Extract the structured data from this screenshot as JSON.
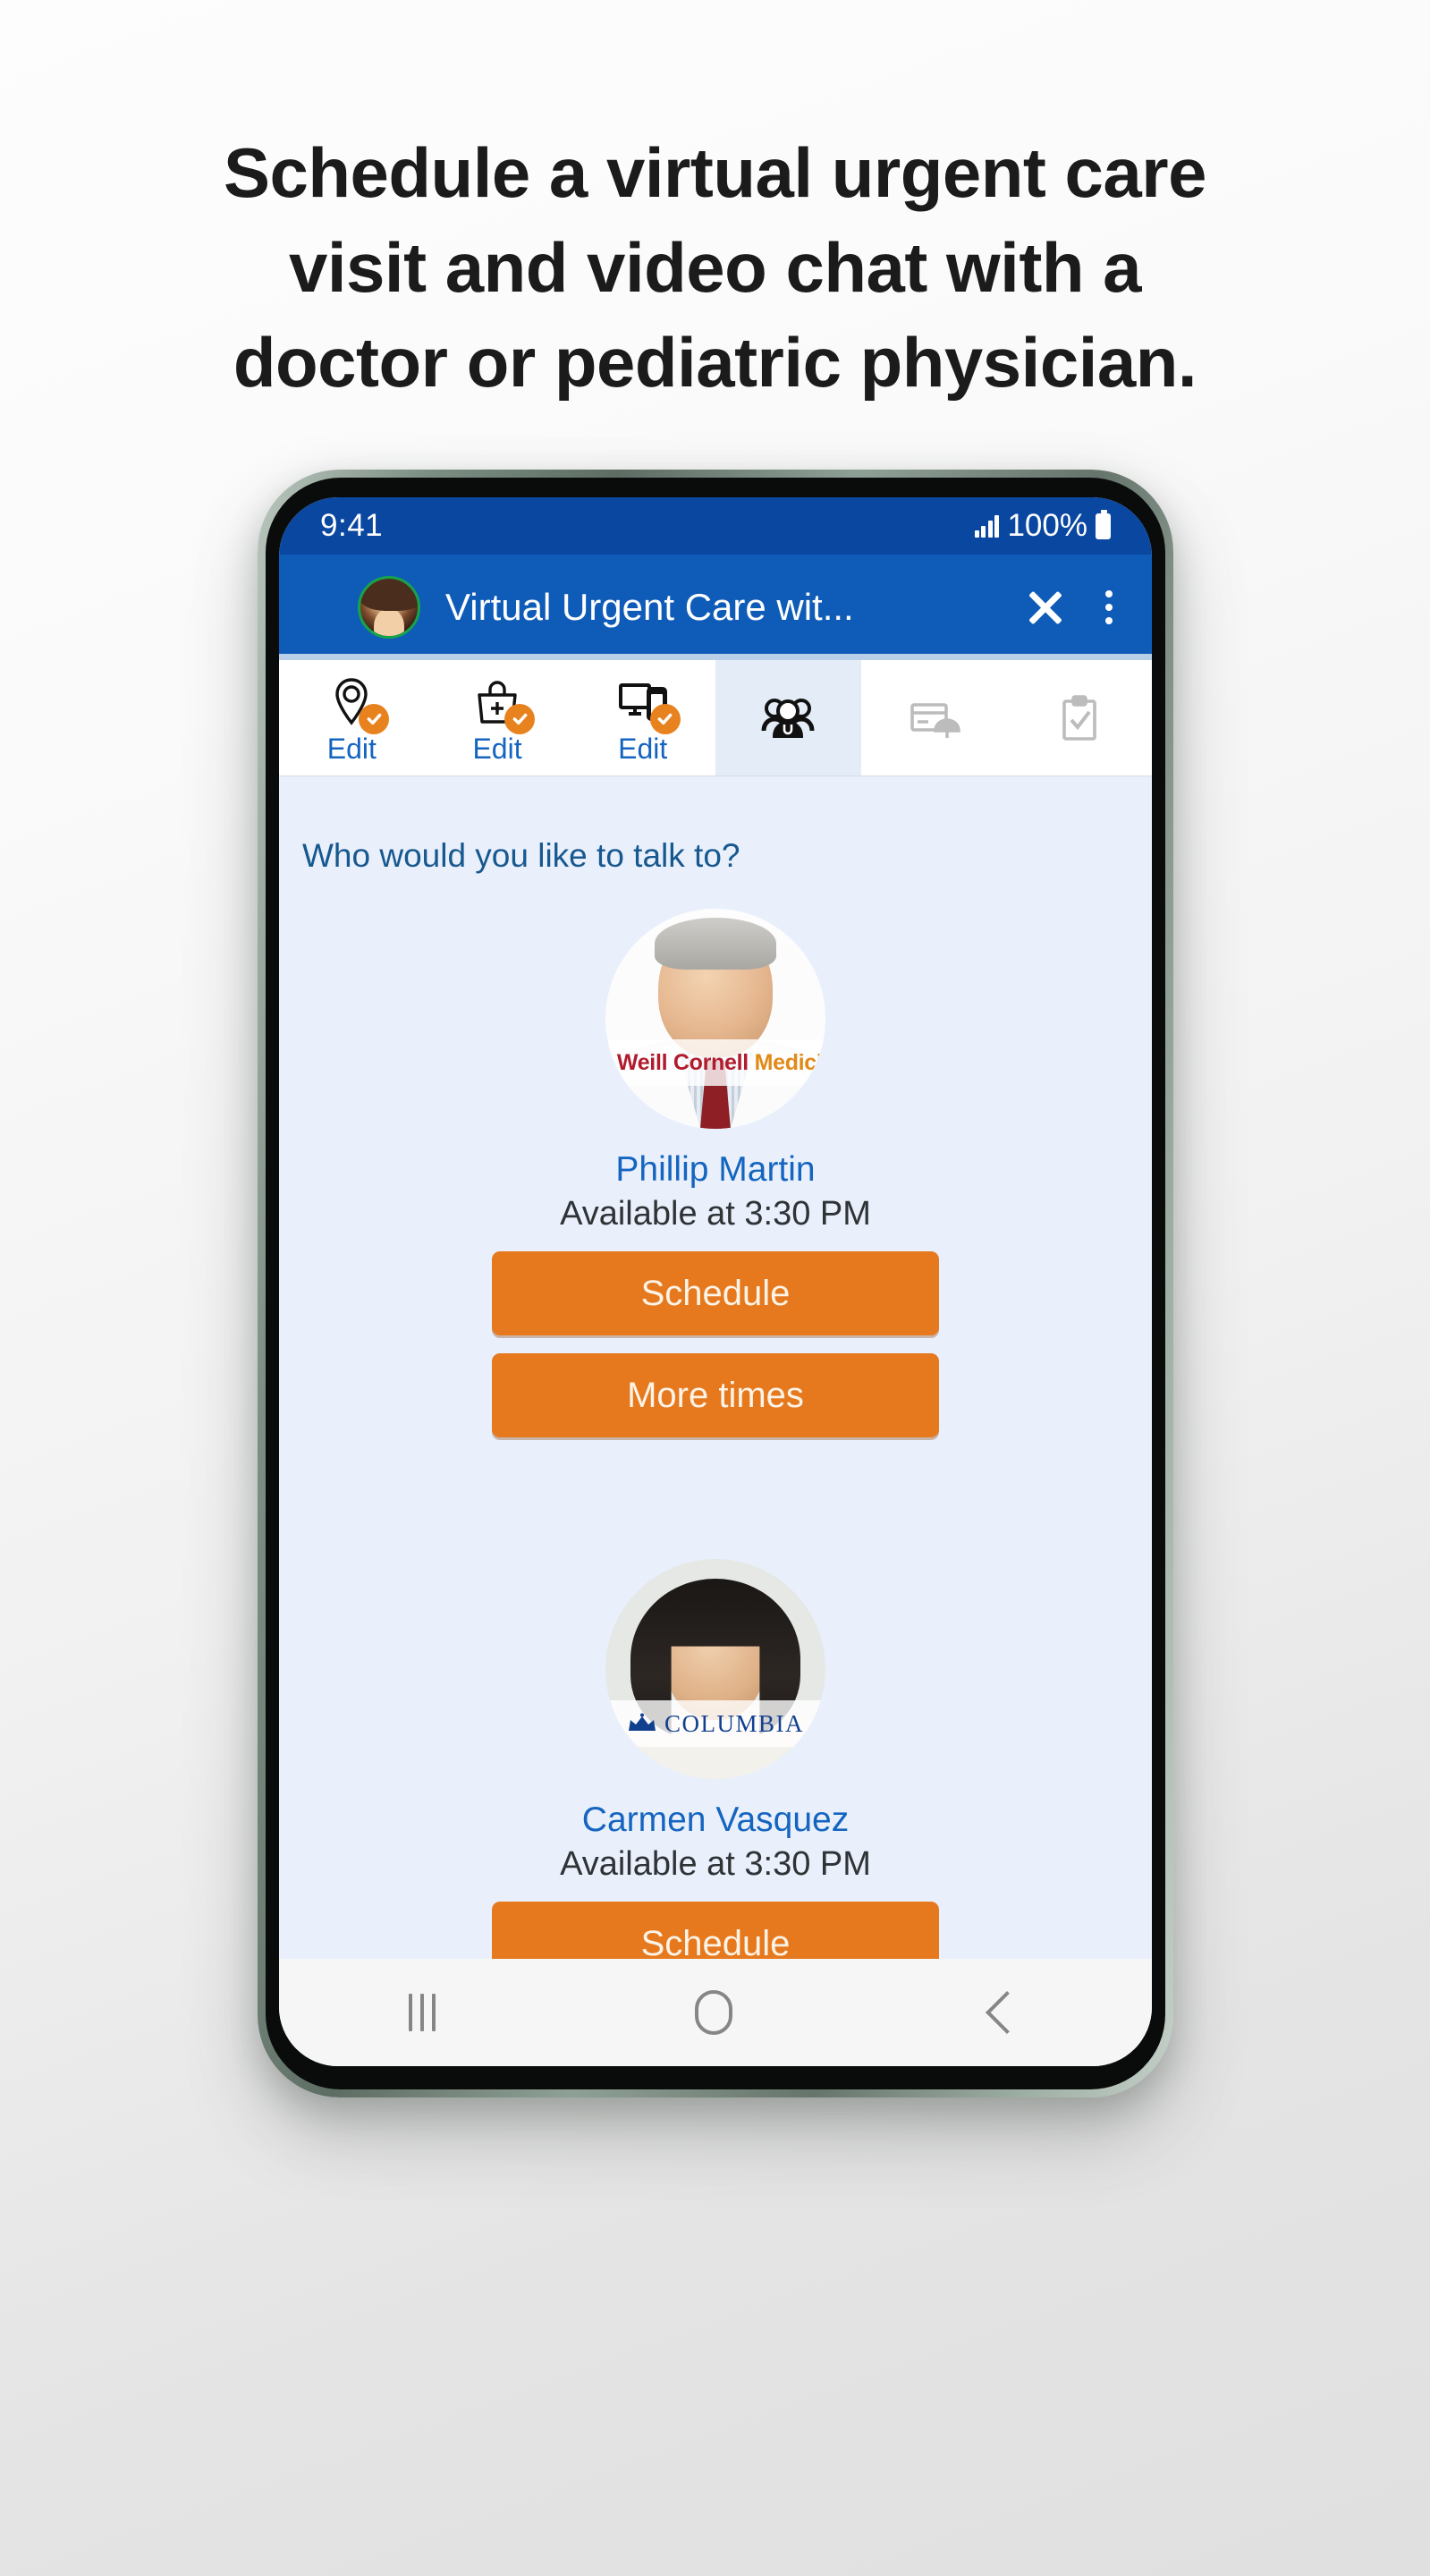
{
  "headline": {
    "lines": [
      "Schedule a virtual urgent care",
      "visit and video chat with a",
      "doctor or pediatric physician."
    ]
  },
  "phone": {
    "statusbar": {
      "time": "9:41",
      "battery_percent": "100%",
      "signal_icon": "signal-bars-icon",
      "battery_icon": "battery-full-icon"
    },
    "appbar": {
      "avatar_icon": "user-avatar",
      "title": "Virtual Urgent Care wit...",
      "close_icon": "close-icon",
      "menu_icon": "overflow-menu-icon"
    },
    "tabs": [
      {
        "icon": "location-pin-icon",
        "label": "Edit",
        "complete": true,
        "active": false
      },
      {
        "icon": "medical-bag-icon",
        "label": "Edit",
        "complete": true,
        "active": false
      },
      {
        "icon": "devices-icon",
        "label": "Edit",
        "complete": true,
        "active": false
      },
      {
        "icon": "people-icon",
        "label": "",
        "complete": false,
        "active": true
      },
      {
        "icon": "insurance-card-icon",
        "label": "",
        "complete": false,
        "active": false
      },
      {
        "icon": "clipboard-check-icon",
        "label": "",
        "complete": false,
        "active": false
      }
    ],
    "content": {
      "question": "Who would you like to talk to?",
      "providers": [
        {
          "name": "Phillip Martin",
          "availability": "Available at 3:30 PM",
          "affiliation": "Weill Cornell Medicine",
          "affiliation_part1": "Weill Cornell ",
          "affiliation_part2": "Medicine",
          "primary_button": "Schedule",
          "secondary_button": "More times"
        },
        {
          "name": "Carmen Vasquez",
          "availability": "Available at 3:30 PM",
          "affiliation": "COLUMBIA",
          "primary_button": "Schedule",
          "secondary_button": ""
        }
      ]
    },
    "navbar": {
      "recent_icon": "recent-apps-icon",
      "home_icon": "home-icon",
      "back_icon": "back-icon"
    }
  },
  "colors": {
    "statusbar_blue": "#0a47a0",
    "appbar_blue": "#0f5cb8",
    "accent_orange": "#e6791e",
    "link_blue": "#1565c0",
    "content_bg": "#e9f0fc",
    "active_tab_bg": "#e4edf7"
  }
}
